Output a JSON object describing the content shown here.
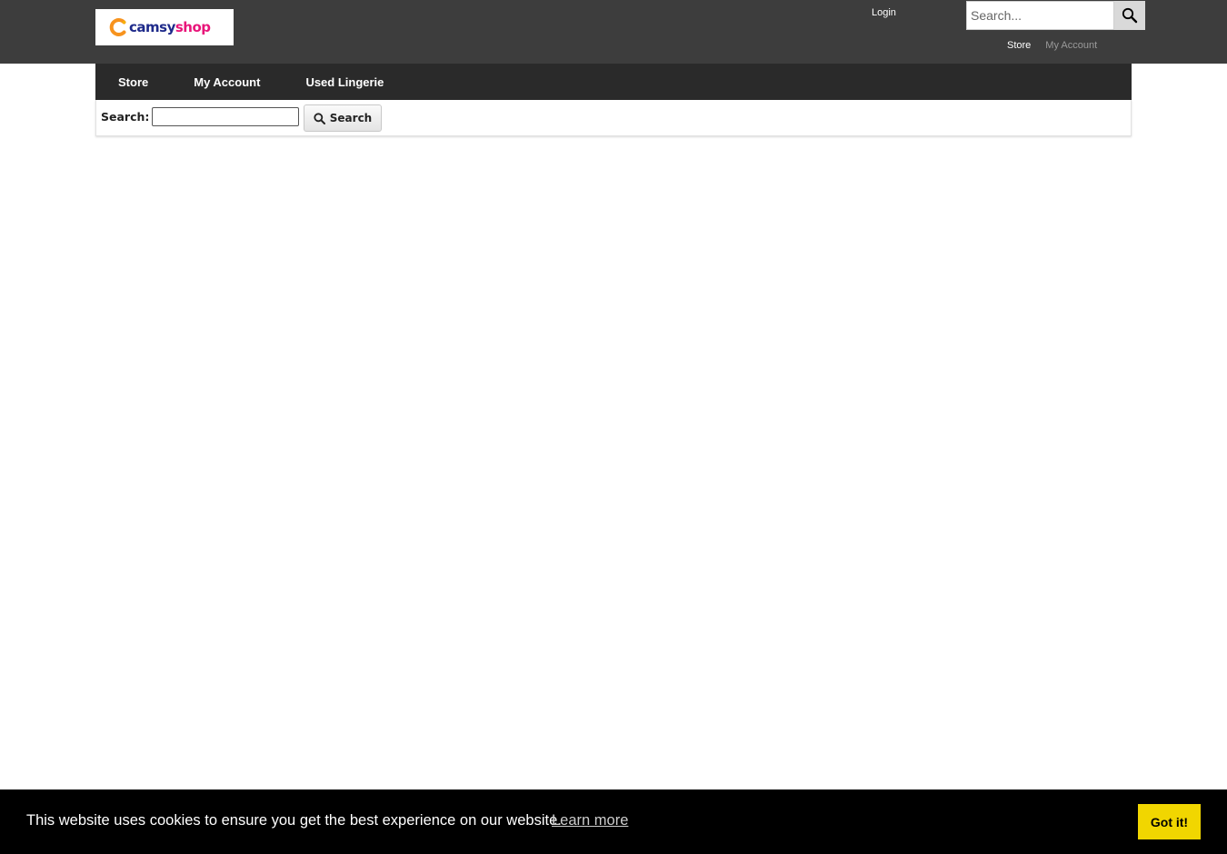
{
  "header": {
    "logo": {
      "text_part1": "camsy",
      "text_part2": "shop"
    },
    "login_label": "Login",
    "search_placeholder": "Search...",
    "links": {
      "store": "Store",
      "my_account": "My Account"
    }
  },
  "nav": {
    "items": [
      {
        "label": "Store"
      },
      {
        "label": "My Account"
      },
      {
        "label": "Used Lingerie"
      }
    ]
  },
  "search_bar": {
    "label": "Search:",
    "input_value": "",
    "button_label": "Search"
  },
  "cookie": {
    "message": "This website uses cookies to ensure you get the best experience on our website.",
    "learn_more": "Learn more",
    "accept": "Got it!"
  },
  "colors": {
    "header_bg": "#3d3d3d",
    "nav_bg": "#2a2a2a",
    "cookie_bg": "#000000",
    "cookie_button": "#f1d600",
    "logo_orange": "#f7931e",
    "logo_navy": "#1e2a8a",
    "logo_pink": "#e8157a"
  },
  "icons": {
    "top_search": "magnifier-icon",
    "search_button": "magnifier-icon"
  }
}
